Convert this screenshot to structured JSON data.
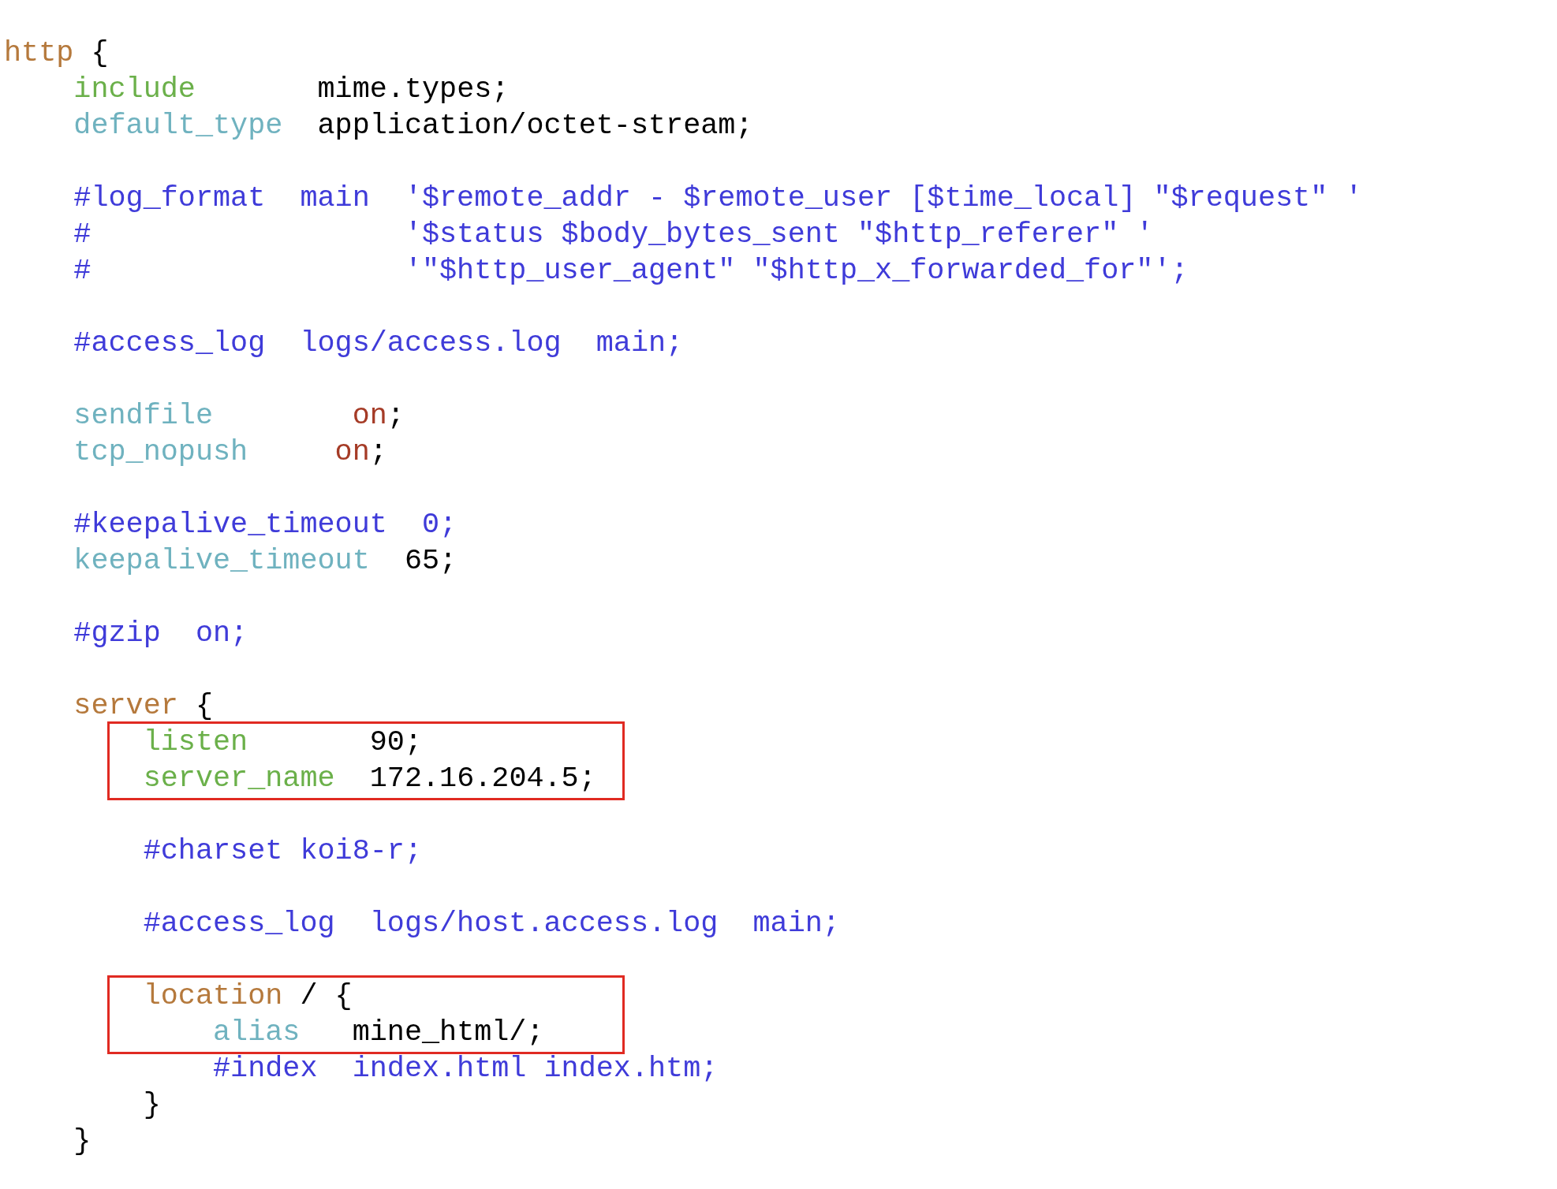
{
  "editor": {
    "paragraphs": [
      {
        "groups": [
          {
            "highlighted": false,
            "lines": [
              {
                "tokens": [
                  {
                    "text": "http",
                    "kind": "block"
                  },
                  {
                    "text": " {",
                    "kind": "plain"
                  }
                ]
              },
              {
                "tokens": [
                  {
                    "text": "    include",
                    "kind": "directive"
                  },
                  {
                    "text": "       mime.types;",
                    "kind": "plain"
                  }
                ]
              },
              {
                "tokens": [
                  {
                    "text": "    default_type",
                    "kind": "builtin"
                  },
                  {
                    "text": "  application/octet-stream;",
                    "kind": "plain"
                  }
                ]
              }
            ]
          }
        ]
      },
      {
        "groups": [
          {
            "highlighted": false,
            "lines": [
              {
                "tokens": [
                  {
                    "text": "    #log_format  main  '$remote_addr - $remote_user [$time_local] \"$request\" '",
                    "kind": "comment"
                  }
                ]
              },
              {
                "tokens": [
                  {
                    "text": "    #                  '$status $body_bytes_sent \"$http_referer\" '",
                    "kind": "comment"
                  }
                ]
              },
              {
                "tokens": [
                  {
                    "text": "    #                  '\"$http_user_agent\" \"$http_x_forwarded_for\"';",
                    "kind": "comment"
                  }
                ]
              }
            ]
          }
        ]
      },
      {
        "groups": [
          {
            "highlighted": false,
            "lines": [
              {
                "tokens": [
                  {
                    "text": "    #access_log  logs/access.log  main;",
                    "kind": "comment"
                  }
                ]
              }
            ]
          }
        ]
      },
      {
        "groups": [
          {
            "highlighted": false,
            "lines": [
              {
                "tokens": [
                  {
                    "text": "    sendfile",
                    "kind": "builtin"
                  },
                  {
                    "text": "        on",
                    "kind": "literal"
                  },
                  {
                    "text": ";",
                    "kind": "plain"
                  }
                ]
              },
              {
                "tokens": [
                  {
                    "text": "    tcp_nopush",
                    "kind": "builtin"
                  },
                  {
                    "text": "     on",
                    "kind": "literal"
                  },
                  {
                    "text": ";",
                    "kind": "plain"
                  }
                ]
              }
            ]
          }
        ]
      },
      {
        "groups": [
          {
            "highlighted": false,
            "lines": [
              {
                "tokens": [
                  {
                    "text": "    #keepalive_timeout  0;",
                    "kind": "comment"
                  }
                ]
              },
              {
                "tokens": [
                  {
                    "text": "    keepalive_timeout",
                    "kind": "builtin"
                  },
                  {
                    "text": "  65;",
                    "kind": "plain"
                  }
                ]
              }
            ]
          }
        ]
      },
      {
        "groups": [
          {
            "highlighted": false,
            "lines": [
              {
                "tokens": [
                  {
                    "text": "    #gzip  on;",
                    "kind": "comment"
                  }
                ]
              }
            ]
          }
        ]
      },
      {
        "groups": [
          {
            "highlighted": false,
            "lines": [
              {
                "tokens": [
                  {
                    "text": "    server",
                    "kind": "block"
                  },
                  {
                    "text": " {",
                    "kind": "plain"
                  }
                ]
              }
            ]
          },
          {
            "highlighted": true,
            "lines": [
              {
                "tokens": [
                  {
                    "text": "        listen",
                    "kind": "directive"
                  },
                  {
                    "text": "       90;",
                    "kind": "plain"
                  }
                ]
              },
              {
                "tokens": [
                  {
                    "text": "        server_name",
                    "kind": "directive"
                  },
                  {
                    "text": "  172.16.204.5;",
                    "kind": "plain"
                  }
                ]
              }
            ]
          }
        ]
      },
      {
        "groups": [
          {
            "highlighted": false,
            "lines": [
              {
                "tokens": [
                  {
                    "text": "        #charset koi8-r;",
                    "kind": "comment"
                  }
                ]
              }
            ]
          }
        ]
      },
      {
        "groups": [
          {
            "highlighted": false,
            "lines": [
              {
                "tokens": [
                  {
                    "text": "        #access_log  logs/host.access.log  main;",
                    "kind": "comment"
                  }
                ]
              }
            ]
          }
        ]
      },
      {
        "groups": [
          {
            "highlighted": true,
            "lines": [
              {
                "tokens": [
                  {
                    "text": "        location",
                    "kind": "block"
                  },
                  {
                    "text": " / {",
                    "kind": "plain"
                  }
                ]
              },
              {
                "tokens": [
                  {
                    "text": "            alias",
                    "kind": "builtin"
                  },
                  {
                    "text": "   mine_html/;",
                    "kind": "plain"
                  }
                ]
              }
            ]
          },
          {
            "highlighted": false,
            "lines": [
              {
                "tokens": [
                  {
                    "text": "            #index  index.html index.htm;",
                    "kind": "comment"
                  }
                ]
              },
              {
                "tokens": [
                  {
                    "text": "        }",
                    "kind": "plain"
                  }
                ]
              },
              {
                "tokens": [
                  {
                    "text": "    }",
                    "kind": "plain"
                  }
                ]
              }
            ]
          }
        ]
      }
    ]
  }
}
